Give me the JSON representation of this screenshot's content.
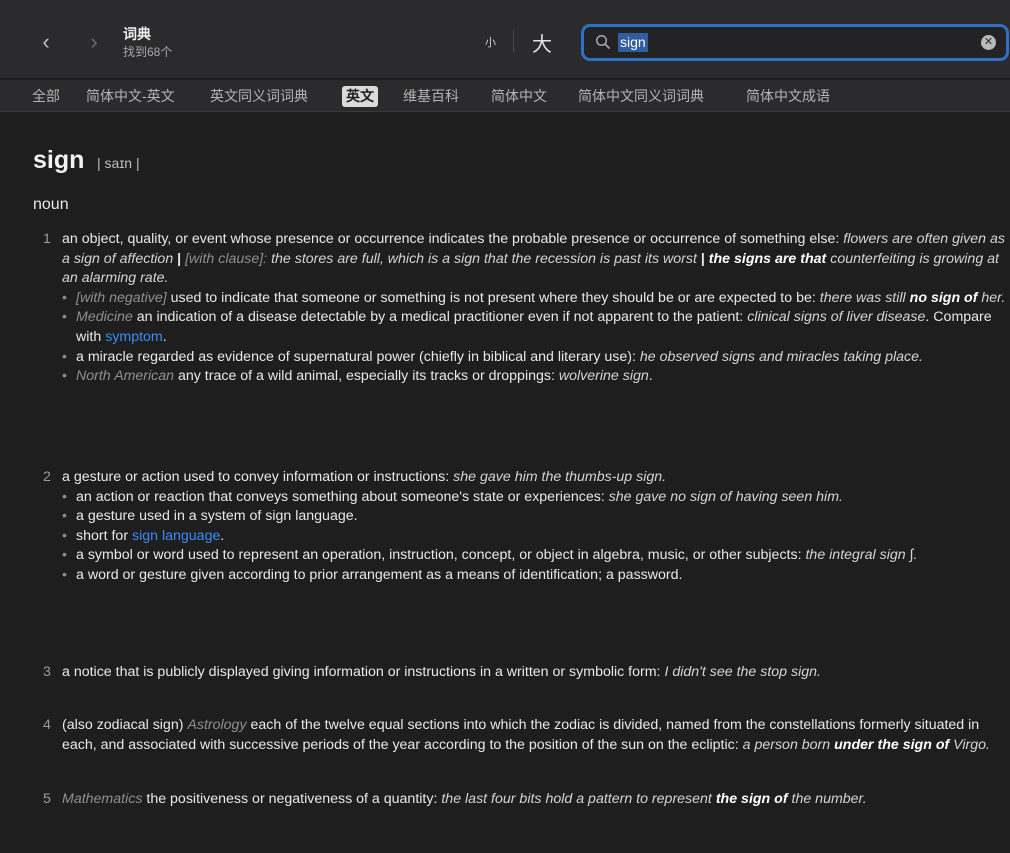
{
  "window": {
    "title": "词典",
    "subtitle": "找到68个",
    "font_small_label": "小",
    "font_large_label": "大"
  },
  "search": {
    "value": "sign"
  },
  "tabs": [
    "全部",
    "简体中文-英文",
    "英文同义词词典",
    "英文",
    "维基百科",
    "简体中文",
    "简体中文同义词词典",
    "简体中文成语"
  ],
  "active_tab": "英文",
  "entry": {
    "headword": "sign",
    "pronunciation": "| saɪn |",
    "pos": "noun",
    "senses": [
      {
        "num": "1",
        "main": {
          "def": "an object, quality, or event whose presence or occurrence indicates the probable presence or occurrence of something else:",
          "ex1": "flowers are often given as a sign of affection",
          "sep1": "|",
          "lbl1": "[with clause]:",
          "ex2": "the stores are full, which is a sign that the recession is past its worst",
          "sep2": "|",
          "exb": "the signs are that",
          "ex3": "counterfeiting is growing at an alarming rate."
        },
        "subs": [
          {
            "lbl": "[with negative]",
            "def": "used to indicate that someone or something is not present where they should be or are expected to be:",
            "ex": "there was still",
            "exb": "no sign of",
            "ex_tail": "her."
          },
          {
            "lbl": "Medicine",
            "def": "an indication of a disease detectable by a medical practitioner even if not apparent to the patient:",
            "ex": "clinical signs of liver disease",
            "tail": ". Compare with",
            "link": "symptom",
            "end": "."
          },
          {
            "def": "a miracle regarded as evidence of supernatural power (chiefly in biblical and literary use):",
            "ex": "he observed signs and miracles taking place."
          },
          {
            "lbl": "North American",
            "def": "any trace of a wild animal, especially its tracks or droppings:",
            "ex": "wolverine sign",
            "end": "."
          }
        ]
      },
      {
        "num": "2",
        "main": {
          "def": "a gesture or action used to convey information or instructions:",
          "ex": "she gave him the thumbs-up sign."
        },
        "subs": [
          {
            "def": "an action or reaction that conveys something about someone's state or experiences:",
            "ex": "she gave no sign of having seen him."
          },
          {
            "def": "a gesture used in a system of sign language."
          },
          {
            "def": "short for",
            "link": "sign language",
            "end": "."
          },
          {
            "def": "a symbol or word used to represent an operation, instruction, concept, or object in algebra, music, or other subjects:",
            "ex": "the integral sign ∫."
          },
          {
            "def": "a word or gesture given according to prior arrangement as a means of identification; a password."
          }
        ]
      },
      {
        "num": "3",
        "main": {
          "def": "a notice that is publicly displayed giving information or instructions in a written or symbolic form:",
          "ex": "I didn't see the stop sign."
        }
      },
      {
        "num": "4",
        "main": {
          "def_pre": "(also zodiacal sign)",
          "lbl": "Astrology",
          "def": "each of the twelve equal sections into which the zodiac is divided, named from the constellations formerly situated in each, and associated with successive periods of the year according to the position of the sun on the ecliptic:",
          "ex": "a person born",
          "exb": "under the sign of",
          "ex_tail": "Virgo."
        }
      },
      {
        "num": "5",
        "main": {
          "lbl": "Mathematics",
          "def": "the positiveness or negativeness of a quantity:",
          "ex": "the last four bits hold a pattern to represent",
          "exb": "the sign of",
          "ex_tail": "the number."
        }
      }
    ]
  }
}
